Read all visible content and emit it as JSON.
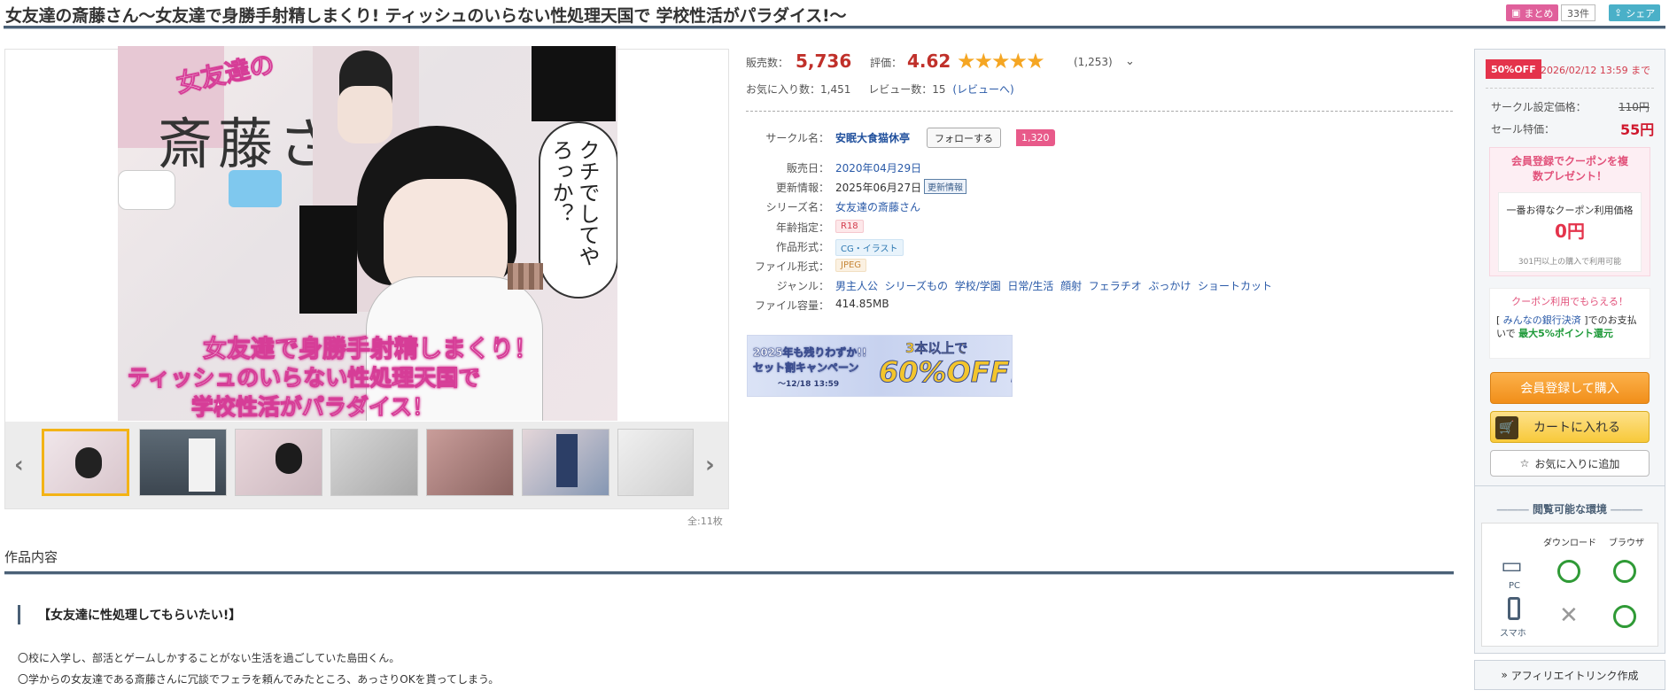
{
  "page": {
    "title": "女友達の斎藤さん〜女友達で身勝手射精しまくり! ティッシュのいらない性処理天国で 学校性活がパラダイス!〜",
    "matome_label": "まとめ",
    "matome_count": "33件",
    "share_label": "シェア"
  },
  "gallery": {
    "cover_title": "女友達の",
    "cover_name": "斎藤さん",
    "cover_bubble": "クチでしてやろっか？",
    "cover_caption_1": "女友達で身勝手射精しまくり！",
    "cover_caption_2": "ティッシュのいらない性処理天国で",
    "cover_caption_3": "学校性活がパラダイス！",
    "thumb_count": 7,
    "total": "全:11枚",
    "prev": "‹",
    "next": "›"
  },
  "stats": {
    "sales_label": "販売数：",
    "sales_value": "5,736",
    "rating_label": "評価：",
    "rating_value": "4.62",
    "stars": "★★★★★",
    "rating_count": "(1,253)",
    "favorites_label": "お気に入り数：",
    "favorites_value": "1,451",
    "reviews_label": "レビュー数：",
    "reviews_value": "15",
    "reviews_link": "(レビューへ)"
  },
  "details": {
    "circle_label": "サークル名：",
    "circle_name": "安眠大食猫休亭",
    "follow_label": "フォローする",
    "follow_count": "1,320",
    "release_label": "販売日：",
    "release_date": "2020年04月29日",
    "update_label": "更新情報：",
    "update_date": "2025年06月27日",
    "update_button": "更新情報",
    "series_label": "シリーズ名：",
    "series_name": "女友達の斎藤さん",
    "age_label": "年齢指定：",
    "age_value": "R18",
    "format_label": "作品形式：",
    "format_value": "CG・イラスト",
    "file_label": "ファイル形式：",
    "file_value": "JPEG",
    "genre_label": "ジャンル：",
    "genres": [
      "男主人公",
      "シリーズもの",
      "学校/学園",
      "日常/生活",
      "顔射",
      "フェラチオ",
      "ぶっかけ",
      "ショートカット"
    ],
    "size_label": "ファイル容量：",
    "size_value": "414.85MB"
  },
  "banner": {
    "line1": "2025年も残りわずか!!",
    "line2": "セット割キャンペーン",
    "line3": "〜12/18 13:59",
    "line4": "3本以上で",
    "line5": "60%OFF!"
  },
  "sidebar": {
    "sale_badge": "50%OFF",
    "sale_until": "2026/02/12 13:59 まで",
    "regular_label": "サークル設定価格：",
    "regular_price": "110円",
    "sale_label": "セール特価：",
    "sale_price": "55円",
    "coupon_title": "会員登録でクーポンを複数プレゼント！",
    "coupon_best_label": "一番お得なクーポン利用価格",
    "coupon_price": "0円",
    "coupon_note": "301円以上の購入で利用可能",
    "coupon_use_title": "クーポン利用でもらえる！",
    "pay_text_1": "[ ",
    "pay_link": "みんなの銀行決済",
    "pay_text_2": " ]でのお支払いで ",
    "pay_reward": "最大5%ポイント還元",
    "register_buy": "会員登録して購入",
    "add_cart": "カートに入れる",
    "add_fav": "お気に入りに追加",
    "env_title": "閲覧可能な環境",
    "env_col_download": "ダウンロード",
    "env_col_browser": "ブラウザ",
    "env_pc": "PC",
    "env_phone": "スマホ",
    "affiliate": "アフィリエイトリンク作成"
  },
  "content": {
    "section_title": "作品内容",
    "subheading": "【女友達に性処理してもらいたい!】",
    "paragraphs": [
      "〇校に入学し、部活とゲームしかすることがない生活を過ごしていた島田くん。",
      "〇学からの女友達である斎藤さんに冗談でフェラを頼んでみたところ、あっさりOKを貰ってしまう。"
    ]
  },
  "colors": {
    "accent_red": "#c0302a",
    "star": "#f5a623",
    "rule": "#4a6076"
  }
}
